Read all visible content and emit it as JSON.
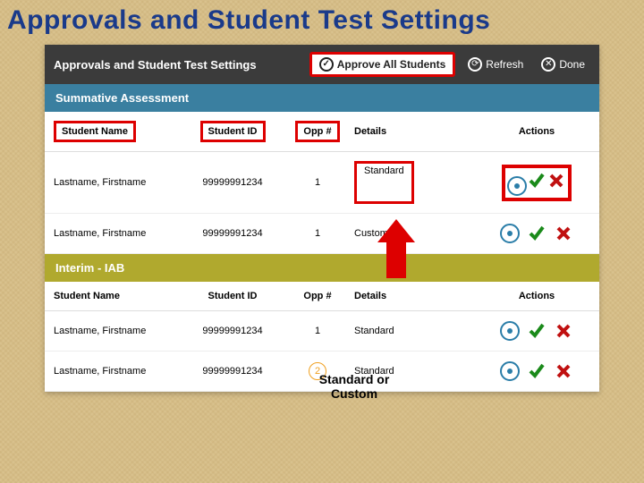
{
  "slide_title": "Approvals and Student Test Settings",
  "panel": {
    "title": "Approvals and Student Test Settings",
    "buttons": {
      "approve_all": "Approve All Students",
      "refresh": "Refresh",
      "done": "Done"
    }
  },
  "columns": {
    "name": "Student Name",
    "id": "Student ID",
    "opp": "Opp #",
    "details": "Details",
    "actions": "Actions"
  },
  "sections": [
    {
      "key": "summative",
      "title": "Summative Assessment",
      "highlight_headers": true,
      "highlight_actions": true,
      "rows": [
        {
          "name": "Lastname, Firstname",
          "id": "99999991234",
          "opp": "1",
          "details": "Standard"
        },
        {
          "name": "Lastname, Firstname",
          "id": "99999991234",
          "opp": "1",
          "details": "Custom"
        }
      ]
    },
    {
      "key": "interim",
      "title": "Interim - IAB",
      "highlight_headers": false,
      "highlight_actions": false,
      "rows": [
        {
          "name": "Lastname, Firstname",
          "id": "99999991234",
          "opp": "1",
          "details": "Standard"
        },
        {
          "name": "Lastname, Firstname",
          "id": "99999991234",
          "opp": "2",
          "opp_badge": true,
          "details": "Standard"
        }
      ]
    }
  ],
  "callout": "Standard or Custom",
  "icons": {
    "check": "check-icon",
    "refresh": "refresh-icon",
    "close": "close-icon",
    "eye": "eye-icon",
    "approve": "approve-icon",
    "deny": "deny-icon"
  }
}
